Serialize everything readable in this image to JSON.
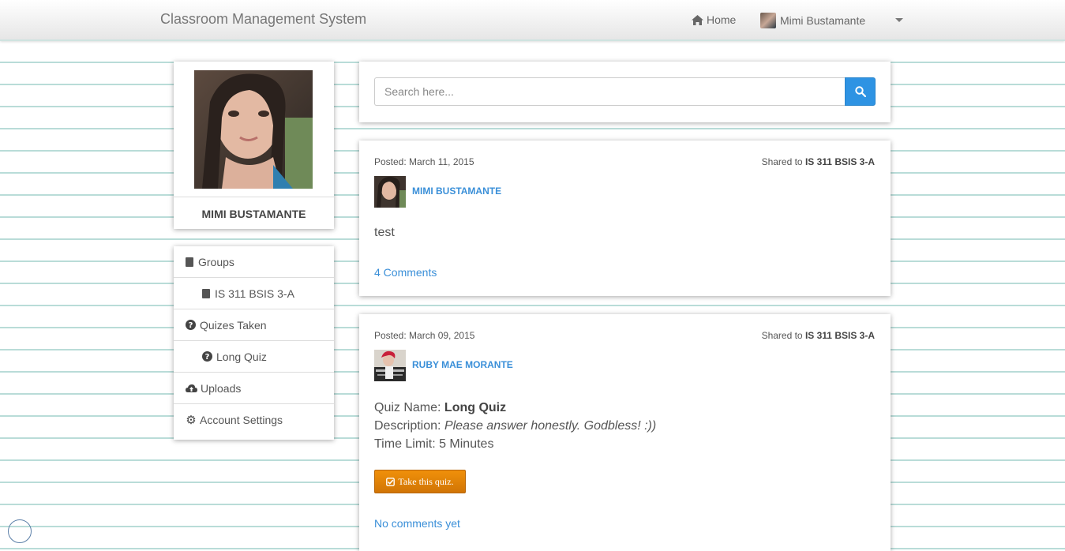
{
  "navbar": {
    "brand": "Classroom Management System",
    "home_label": "Home",
    "user_name": "Mimi Bustamante"
  },
  "profile": {
    "name": "MIMI BUSTAMANTE"
  },
  "menu": {
    "items": [
      {
        "label": "Groups",
        "icon": "book-icon"
      },
      {
        "label": "IS 311 BSIS 3-A",
        "icon": "book-icon"
      },
      {
        "label": "Quizes Taken",
        "icon": "question-circle-icon"
      },
      {
        "label": "Long Quiz",
        "icon": "question-circle-icon"
      },
      {
        "label": "Uploads",
        "icon": "cloud-upload-icon"
      },
      {
        "label": "Account Settings",
        "icon": "gear-icon"
      }
    ]
  },
  "search": {
    "placeholder": "Search here...",
    "icon": "search-icon"
  },
  "posts": [
    {
      "posted": "Posted: March 11, 2015",
      "shared_prefix": "Shared to",
      "shared_group": "IS 311 BSIS 3-A",
      "author": "MIMI BUSTAMANTE",
      "body": "test",
      "comments": "4 Comments"
    },
    {
      "posted": "Posted: March 09, 2015",
      "shared_prefix": "Shared to",
      "shared_group": "IS 311 BSIS 3-A",
      "author": "RUBY MAE MORANTE",
      "quiz_name_label": "Quiz Name:",
      "quiz_name": "Long Quiz",
      "description_label": "Description:",
      "description": "Please answer honestly. Godbless! :))",
      "time_limit": "Time Limit: 5 Minutes",
      "button_label": "Take this quiz.",
      "comments": "No comments yet"
    }
  ],
  "colors": {
    "link": "#3a8fd8",
    "search_button": "#2e93e3",
    "quiz_button": "#e3860a",
    "ruled_lines": "#b9dcd8"
  }
}
